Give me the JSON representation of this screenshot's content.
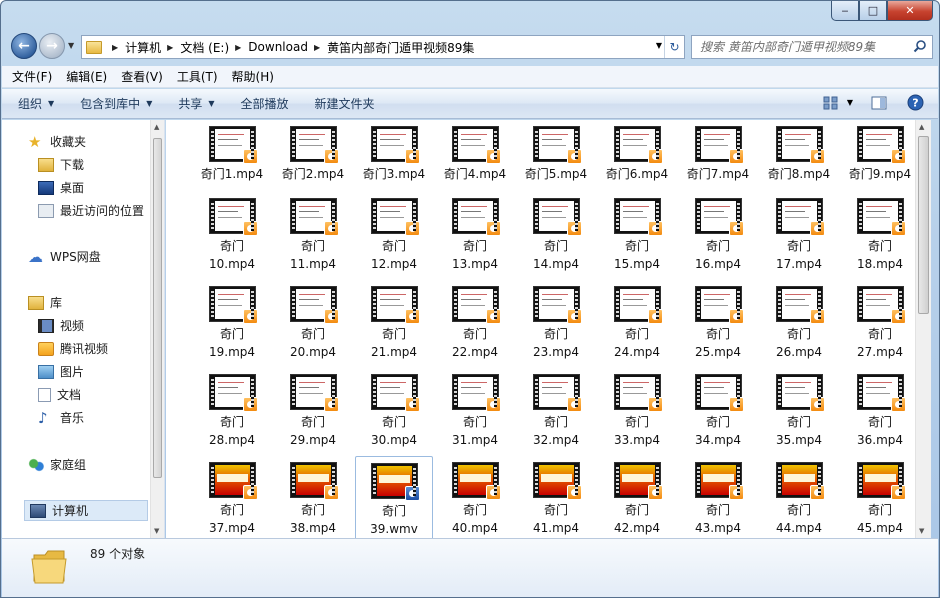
{
  "window": {
    "minimize": "‒",
    "maximize": "□",
    "close": "✕"
  },
  "address": {
    "crumbs": [
      "计算机",
      "文档 (E:)",
      "Download",
      "黄笛内部奇门遁甲视频89集"
    ]
  },
  "search": {
    "placeholder": "搜索 黄笛内部奇门遁甲视频89集"
  },
  "menu": [
    "文件(F)",
    "编辑(E)",
    "查看(V)",
    "工具(T)",
    "帮助(H)"
  ],
  "commands": {
    "organize": "组织",
    "include": "包含到库中",
    "share": "共享",
    "play_all": "全部播放",
    "new_folder": "新建文件夹"
  },
  "nav": {
    "favorites": "收藏夹",
    "downloads": "下载",
    "desktop": "桌面",
    "recent": "最近访问的位置",
    "wps": "WPS网盘",
    "libraries": "库",
    "videos": "视频",
    "tencent": "腾讯视频",
    "pictures": "图片",
    "documents": "文档",
    "music": "音乐",
    "homegroup": "家庭组",
    "computer": "计算机"
  },
  "files": [
    {
      "name": "奇门1.mp4"
    },
    {
      "name": "奇门2.mp4"
    },
    {
      "name": "奇门3.mp4"
    },
    {
      "name": "奇门4.mp4"
    },
    {
      "name": "奇门5.mp4"
    },
    {
      "name": "奇门6.mp4"
    },
    {
      "name": "奇门7.mp4"
    },
    {
      "name": "奇门8.mp4"
    },
    {
      "name": "奇门9.mp4"
    },
    {
      "name": "奇门\n10.mp4"
    },
    {
      "name": "奇门\n11.mp4"
    },
    {
      "name": "奇门\n12.mp4"
    },
    {
      "name": "奇门\n13.mp4"
    },
    {
      "name": "奇门\n14.mp4"
    },
    {
      "name": "奇门\n15.mp4"
    },
    {
      "name": "奇门\n16.mp4"
    },
    {
      "name": "奇门\n17.mp4"
    },
    {
      "name": "奇门\n18.mp4"
    },
    {
      "name": "奇门\n19.mp4"
    },
    {
      "name": "奇门\n20.mp4"
    },
    {
      "name": "奇门\n21.mp4"
    },
    {
      "name": "奇门\n22.mp4"
    },
    {
      "name": "奇门\n23.mp4"
    },
    {
      "name": "奇门\n24.mp4"
    },
    {
      "name": "奇门\n25.mp4"
    },
    {
      "name": "奇门\n26.mp4"
    },
    {
      "name": "奇门\n27.mp4"
    },
    {
      "name": "奇门\n28.mp4"
    },
    {
      "name": "奇门\n29.mp4"
    },
    {
      "name": "奇门\n30.mp4"
    },
    {
      "name": "奇门\n31.mp4"
    },
    {
      "name": "奇门\n32.mp4"
    },
    {
      "name": "奇门\n33.mp4"
    },
    {
      "name": "奇门\n34.mp4"
    },
    {
      "name": "奇门\n35.mp4"
    },
    {
      "name": "奇门\n36.mp4"
    },
    {
      "name": "奇门\n37.mp4"
    },
    {
      "name": "奇门\n38.mp4"
    },
    {
      "name": "奇门\n39.wmv"
    },
    {
      "name": "奇门\n40.mp4"
    },
    {
      "name": "奇门\n41.mp4"
    },
    {
      "name": "奇门\n42.mp4"
    },
    {
      "name": "奇门\n43.mp4"
    },
    {
      "name": "奇门\n44.mp4"
    },
    {
      "name": "奇门\n45.mp4"
    }
  ],
  "status": {
    "count": "89 个对象"
  },
  "colors": {
    "accent": "#1e395b",
    "play_badge": "#f38b10",
    "wmv_badge": "#1c4ea3"
  }
}
